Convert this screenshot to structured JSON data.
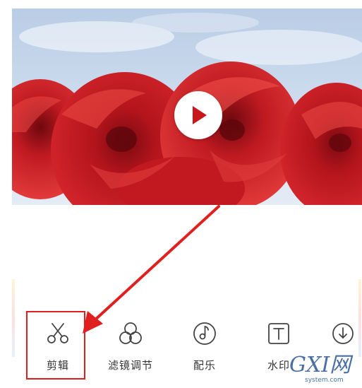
{
  "video": {
    "scene": "red-roses-under-sky"
  },
  "play_button": {
    "icon": "play-icon",
    "color": "#c9171e"
  },
  "toolbar": {
    "items": [
      {
        "label": "剪辑",
        "icon": "scissors-icon"
      },
      {
        "label": "滤镜调节",
        "icon": "filter-circles-icon"
      },
      {
        "label": "配乐",
        "icon": "music-note-icon"
      },
      {
        "label": "水印",
        "icon": "text-box-icon"
      },
      {
        "label": "",
        "icon": "download-icon"
      }
    ]
  },
  "annotation": {
    "highlight_color": "#e0201f",
    "arrow_color": "#e0201f"
  },
  "watermark": {
    "main": "GXI网",
    "sub": "system.com"
  }
}
